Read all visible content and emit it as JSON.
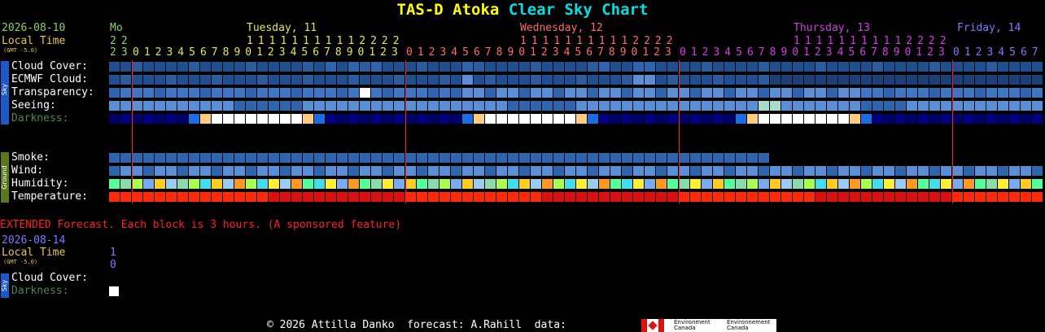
{
  "title": {
    "part1": "TAS-D Atoka",
    "part2": "Clear Sky Chart",
    "color1": "#ffff00",
    "color2": "#00e0e0"
  },
  "header": {
    "date": "2026-08-10",
    "local_time": "Local Time",
    "gmt": "(GMT -5.0)",
    "days": [
      {
        "label": "Mo",
        "color": "#8fd16a"
      },
      {
        "label": "Tuesday, 11",
        "color": "#e6e65a"
      },
      {
        "label": "Wednesday, 12",
        "color": "#ff6b6b"
      },
      {
        "label": "Thursday, 13",
        "color": "#d23ce6"
      },
      {
        "label": "Friday, 14",
        "color": "#7a7aff"
      }
    ],
    "tens_rows": [
      {
        "text": "2 2",
        "color": "#8fd16a"
      },
      {
        "text": "1 1 1 1 1 1 1 1 1 1 2 2 2 2",
        "color": "#e6e65a"
      },
      {
        "text": "1 1 1 1 1 1 1 1 1 1 2 2 2 2",
        "color": "#ff6b6b"
      },
      {
        "text": "1 1 1 1 1 1 1 1 1 1 2 2 2 2",
        "color": "#d23ce6"
      }
    ],
    "hours_segments": [
      {
        "text": "2 3",
        "color": "#8fd16a"
      },
      {
        "text": "0 1 2 3 4 5 6 7 8 9 0 1 2 3 4 5 6 7 8 9 0 1 2 3",
        "color": "#e6e65a"
      },
      {
        "text": "0 1 2 3 4 5 6 7 8 9 0 1 2 3 4 5 6 7 8 9 0 1 2 3",
        "color": "#ff6b6b"
      },
      {
        "text": "0 1 2 3 4 5 6 7 8 9 0 1 2 3 4 5 6 7 8 9 0 1 2 3",
        "color": "#d23ce6"
      },
      {
        "text": "0 1 2 3 4 5 6 7",
        "color": "#7a7aff"
      }
    ]
  },
  "sky_rows": [
    "Cloud Cover:",
    "ECMWF Cloud:",
    "Transparency:",
    "Seeing:",
    "Darkness:"
  ],
  "ground_rows": [
    "Smoke:",
    "Wind:",
    "Humidity:",
    "Temperature:"
  ],
  "side_labels": {
    "sky": "Sky",
    "ground": "Ground",
    "sky2": "Sky"
  },
  "extended": {
    "note": "EXTENDED Forecast. Each block is 3 hours. (A sponsored feature)",
    "date": "2026-08-14",
    "local_time": "Local Time",
    "gmt": "(GMT -5.0)",
    "hour_tens": "1",
    "hour_ones": "0",
    "rows": [
      "Cloud Cover:",
      "Darkness:"
    ]
  },
  "footer": {
    "copyright": "© 2026 Attilla Danko  forecast: A.Rahill  data:",
    "logo_en": "Environment Canada",
    "logo_fr": "Environnement Canada"
  },
  "colors": {
    "label": "#ffffff",
    "darkness_label": "#4a8a4a",
    "local_time": "#e6c84a",
    "date": "#8fd16a",
    "ext_note": "#ff2020",
    "ext_date": "#7a7aff",
    "midnight_line": "#ff2020"
  }
}
